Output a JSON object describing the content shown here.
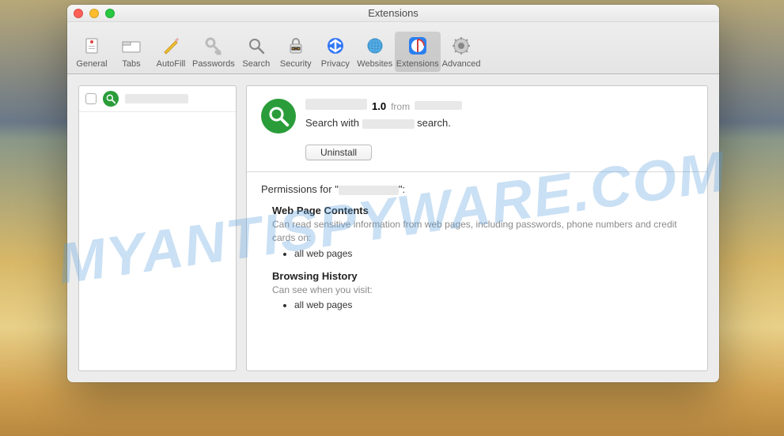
{
  "watermark": "MYANTISPYWARE.COM",
  "window": {
    "title": "Extensions"
  },
  "toolbar": {
    "items": [
      {
        "label": "General"
      },
      {
        "label": "Tabs"
      },
      {
        "label": "AutoFill"
      },
      {
        "label": "Passwords"
      },
      {
        "label": "Search"
      },
      {
        "label": "Security"
      },
      {
        "label": "Privacy"
      },
      {
        "label": "Websites"
      },
      {
        "label": "Extensions"
      },
      {
        "label": "Advanced"
      }
    ]
  },
  "sidebar": {
    "items": [
      {
        "checked": false
      }
    ]
  },
  "detail": {
    "version": "1.0",
    "from_label": "from",
    "description_pre": "Search with",
    "description_post": "search.",
    "uninstall_label": "Uninstall"
  },
  "permissions": {
    "title_pre": "Permissions for \"",
    "title_post": "\":",
    "sections": [
      {
        "heading": "Web Page Contents",
        "text": "Can read sensitive information from web pages, including passwords, phone numbers and credit cards on:",
        "bullets": [
          "all web pages"
        ]
      },
      {
        "heading": "Browsing History",
        "text": "Can see when you visit:",
        "bullets": [
          "all web pages"
        ]
      }
    ]
  }
}
